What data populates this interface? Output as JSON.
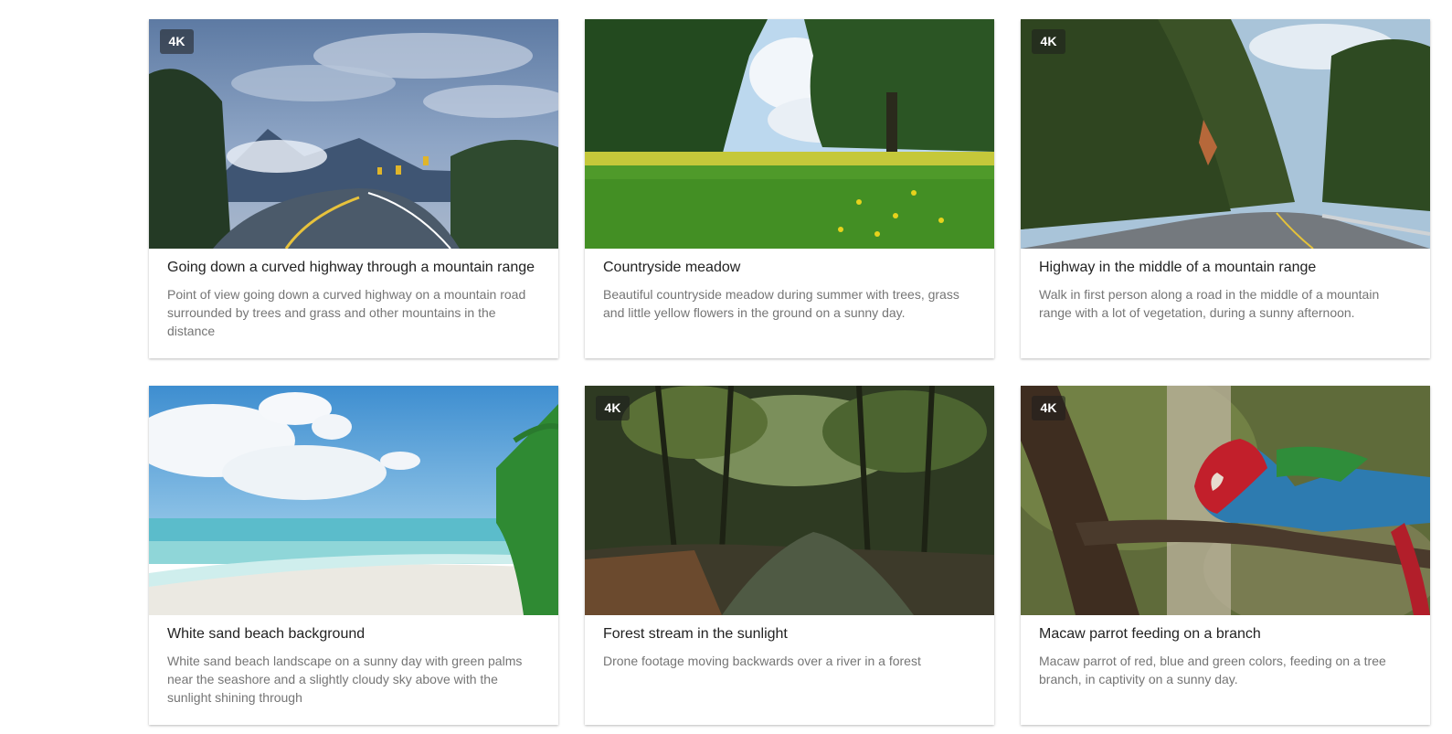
{
  "cards": [
    {
      "badge": "4K",
      "title": "Going down a curved highway through a mountain range",
      "description": "Point of view going down a curved highway on a mountain road surrounded by trees and grass and other mountains in the distance"
    },
    {
      "badge": "",
      "title": "Countryside meadow",
      "description": "Beautiful countryside meadow during summer with trees, grass and little yellow flowers in the ground on a sunny day."
    },
    {
      "badge": "4K",
      "title": "Highway in the middle of a mountain range",
      "description": "Walk in first person along a road in the middle of a mountain range with a lot of vegetation, during a sunny afternoon."
    },
    {
      "badge": "",
      "title": "White sand beach background",
      "description": "White sand beach landscape on a sunny day with green palms near the seashore and a slightly cloudy sky above with the sunlight shining through"
    },
    {
      "badge": "4K",
      "title": "Forest stream in the sunlight",
      "description": "Drone footage moving backwards over a river in a forest"
    },
    {
      "badge": "4K",
      "title": "Macaw parrot feeding on a branch",
      "description": "Macaw parrot of red, blue and green colors, feeding on a tree branch, in captivity on a sunny day."
    }
  ]
}
